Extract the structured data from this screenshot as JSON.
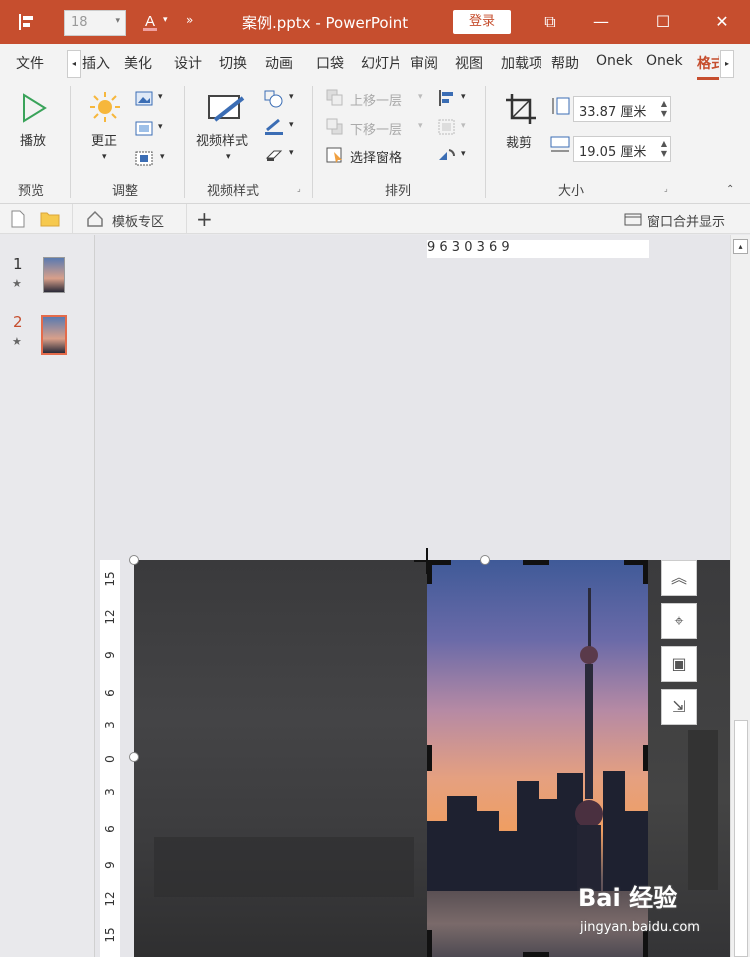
{
  "titlebar": {
    "font_size": "18",
    "title": "案例.pptx  -  PowerPoint",
    "login": "登录"
  },
  "tabs": [
    "文件",
    "插入",
    "美化",
    "设计",
    "切换",
    "动画",
    "口袋",
    "幻灯片",
    "审阅",
    "视图",
    "加载项",
    "帮助",
    "Onek",
    "Onek",
    "格式"
  ],
  "active_tab": "格式",
  "ribbon": {
    "preview": {
      "play": "播放",
      "group": "预览"
    },
    "adjust": {
      "correct": "更正",
      "group": "调整"
    },
    "video_style": {
      "label": "视频样式",
      "group": "视频样式"
    },
    "arrange": {
      "bring_forward": "上移一层",
      "send_backward": "下移一层",
      "selection_pane": "选择窗格",
      "group": "排列"
    },
    "size": {
      "crop": "裁剪",
      "height": "33.87 厘米",
      "width": "19.05 厘米",
      "group": "大小"
    }
  },
  "subbar": {
    "template_zone": "模板专区",
    "add": "+",
    "window_merge": "窗口合并显示"
  },
  "slides": [
    {
      "num": "1",
      "star": "★"
    },
    {
      "num": "2",
      "star": "★"
    }
  ],
  "ruler": {
    "top": "9   6   3   0   3   6   9",
    "left": [
      "15",
      "12",
      "9",
      "6",
      "3",
      "0",
      "3",
      "6",
      "9",
      "12",
      "15"
    ]
  },
  "watermark": {
    "brand": "Bai 经验",
    "url": "jingyan.baidu.com"
  },
  "colors": {
    "accent": "#c64e2e"
  }
}
